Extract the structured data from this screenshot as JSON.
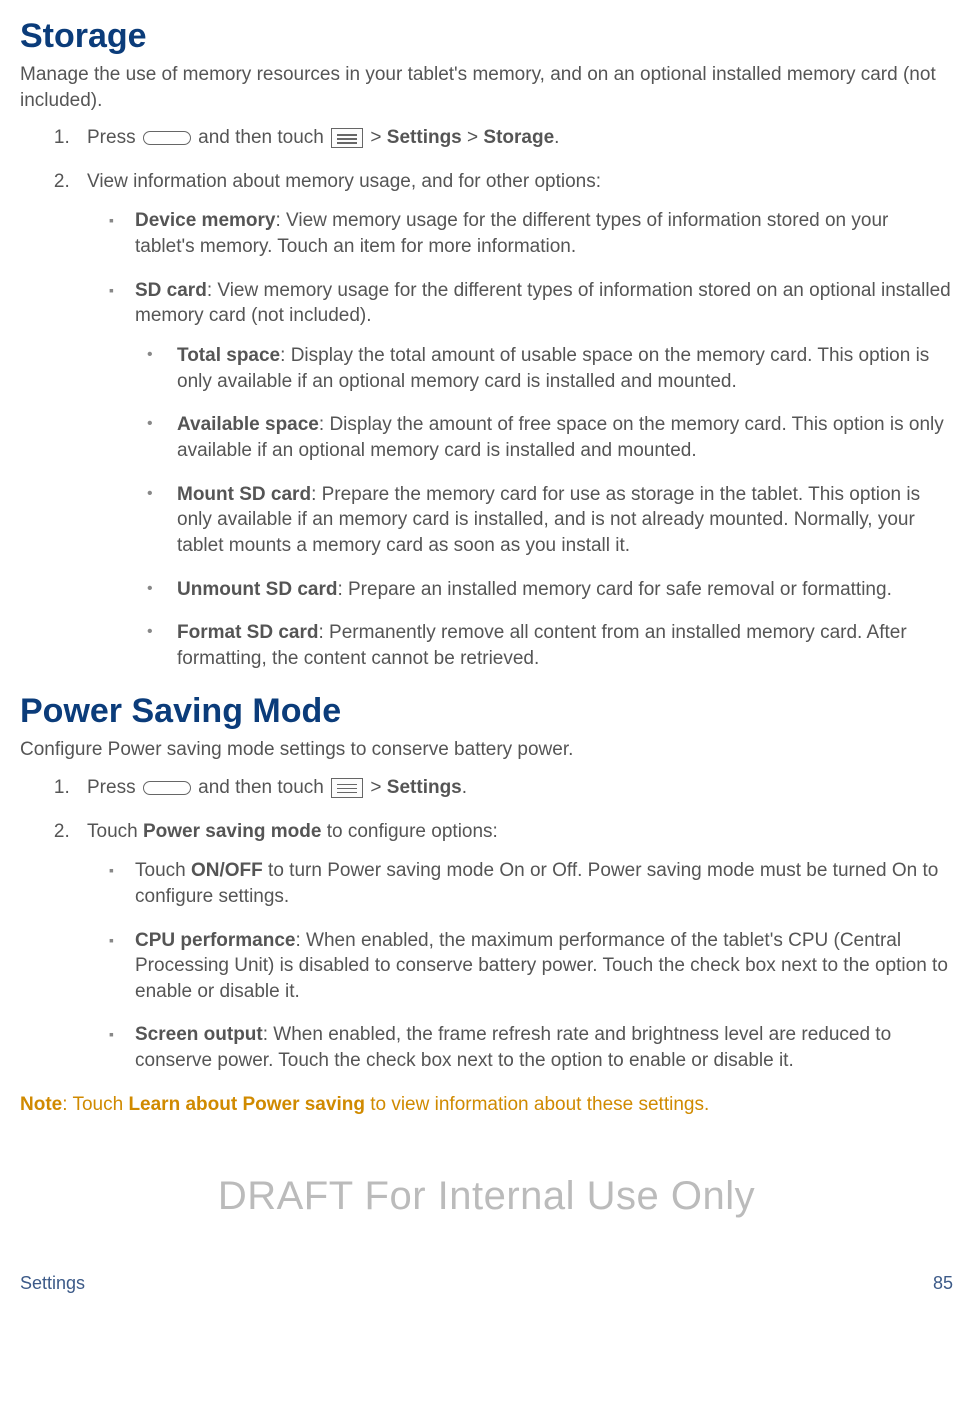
{
  "storage": {
    "heading": "Storage",
    "intro": "Manage the use of memory resources in your tablet's memory, and on an optional installed memory card (not included).",
    "steps": {
      "s1_pre": "Press ",
      "s1_mid": " and then touch ",
      "s1_gt1": " > ",
      "s1_settings": "Settings",
      "s1_gt2": " > ",
      "s1_storage": "Storage",
      "s1_end": ".",
      "s2": "View information about memory usage, and for other options:"
    },
    "device_memory_label": "Device memory",
    "device_memory_text": ": View memory usage for the different types of information stored on your tablet's memory. Touch an item for more information.",
    "sdcard_label": "SD card",
    "sdcard_text": ": View memory usage for the different types of information stored on an optional installed memory card (not included).",
    "sub": {
      "total_label": "Total space",
      "total_text": ": Display the total amount of usable space on the memory card. This option is only available if an optional memory card is installed and mounted.",
      "avail_label": "Available space",
      "avail_text": ": Display the amount of free space on the memory card. This option is only available if an optional memory card is installed and mounted.",
      "mount_label": "Mount SD card",
      "mount_text": ": Prepare the memory card for use as storage in the tablet. This option is only available if an memory card is installed, and is not already mounted. Normally, your tablet mounts a memory card as soon as you install it.",
      "unmount_label": "Unmount SD card",
      "unmount_text": ": Prepare an installed memory card for safe removal or formatting.",
      "format_label": "Format SD card",
      "format_text": ": Permanently remove all content from an installed memory card. After formatting, the content cannot be retrieved."
    }
  },
  "power": {
    "heading": "Power Saving Mode",
    "intro": "Configure Power saving mode settings to conserve battery power.",
    "s1_pre": "Press ",
    "s1_mid": " and then touch ",
    "s1_gt": " > ",
    "s1_settings": "Settings",
    "s1_end": ".",
    "s2_pre": "Touch ",
    "s2_bold": "Power saving mode",
    "s2_post": " to configure options:",
    "opt1_pre": "Touch ",
    "opt1_bold": "ON/OFF",
    "opt1_post": " to turn Power saving mode On or Off. Power saving mode must be turned On to configure settings.",
    "opt2_bold": "CPU performance",
    "opt2_text": ": When enabled, the maximum performance of the tablet's CPU (Central Processing Unit) is disabled to conserve battery power. Touch the check box next to the option to enable or disable it.",
    "opt3_bold": "Screen output",
    "opt3_text": ": When enabled, the frame refresh rate and brightness level are reduced to conserve power. Touch the check box next to the option to enable or disable it."
  },
  "note": {
    "label": "Note",
    "colon": ": Touch ",
    "bold": "Learn about Power saving",
    "tail": " to view information about these settings."
  },
  "watermark": "DRAFT For Internal Use Only",
  "footer": {
    "section": "Settings",
    "page": "85"
  }
}
